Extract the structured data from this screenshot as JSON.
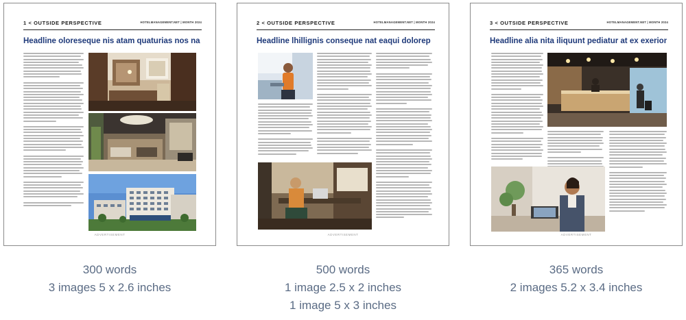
{
  "pages": [
    {
      "section": "1 < OUTSIDE PERSPECTIVE",
      "site": "HOTELMANAGEMENT.NET | MONTH 2024",
      "headline": "Headline oloreseque nis atam quaturias nos nam",
      "ad_label": "ADVERTISEMENT",
      "caption_lines": [
        "300 words",
        "3 images 5 x 2.6 inches"
      ]
    },
    {
      "section": "2 < OUTSIDE PERSPECTIVE",
      "site": "HOTELMANAGEMENT.NET | MONTH 2024",
      "headline": "Headline lhillignis conseque nat eaqui dolorep",
      "ad_label": "ADVERTISEMENT",
      "caption_lines": [
        "500 words",
        "1 image 2.5 x 2 inches",
        "1 image 5 x 3 inches"
      ]
    },
    {
      "section": "3 < OUTSIDE PERSPECTIVE",
      "site": "HOTELMANAGEMENT.NET | MONTH 2024",
      "headline": "Headline alia nita iliquunt pediatur at ex exerion",
      "ad_label": "ADVERTISEMENT",
      "caption_lines": [
        "365 words",
        "2 images 5.2 x 3.4 inches"
      ]
    }
  ]
}
